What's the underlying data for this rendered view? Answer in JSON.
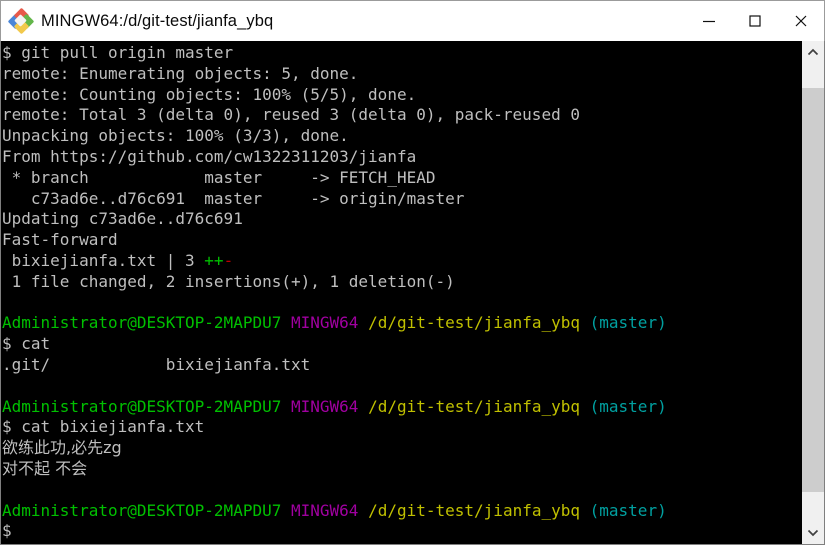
{
  "window": {
    "title": "MINGW64:/d/git-test/jianfa_ybq",
    "icon": "git-bash-diamond-icon",
    "controls": {
      "minimize": "minimize-icon",
      "maximize": "maximize-icon",
      "close": "close-icon"
    }
  },
  "colors": {
    "background": "#000000",
    "foreground": "#bfbfbf",
    "user_host_green": "#00c000",
    "mingw_purple": "#a000a0",
    "path_yellow": "#c0c000",
    "branch_cyan": "#00a0a0",
    "diff_add_green": "#00c000",
    "diff_del_red": "#c00000",
    "titlebar_bg": "#ffffff",
    "titlebar_fg": "#0a0a0a",
    "scrollbar_track": "#f0f0f0",
    "scrollbar_thumb": "#cdcdcd"
  },
  "scrollbar": {
    "up_arrow": "chevron-up-icon",
    "down_arrow": "chevron-down-icon"
  },
  "terminal": {
    "prompt_user_host": "Administrator@DESKTOP-2MAPDU7",
    "prompt_shell": "MINGW64",
    "prompt_path": "/d/git-test/jianfa_ybq",
    "prompt_branch": "(master)",
    "prompt_sigil": "$",
    "lines": {
      "l01": "$ git pull origin master",
      "l02": "remote: Enumerating objects: 5, done.",
      "l03": "remote: Counting objects: 100% (5/5), done.",
      "l04": "remote: Total 3 (delta 0), reused 3 (delta 0), pack-reused 0",
      "l05": "Unpacking objects: 100% (3/3), done.",
      "l06": "From https://github.com/cw1322311203/jianfa",
      "l07": " * branch            master     -> FETCH_HEAD",
      "l08": "   c73ad6e..d76c691  master     -> origin/master",
      "l09": "Updating c73ad6e..d76c691",
      "l10": "Fast-forward",
      "l11_file": " bixiejianfa.txt | 3 ",
      "l11_add": "++",
      "l11_del": "-",
      "l12": " 1 file changed, 2 insertions(+), 1 deletion(-)",
      "l14_cmd": "$ cat",
      "l15": ".git/            bixiejianfa.txt",
      "l18_cmd": "$ cat bixiejianfa.txt",
      "l19_cjk": "欲练此功,必先zg",
      "l20_cjk": "对不起 不会",
      "l23_cmd": "$"
    }
  }
}
